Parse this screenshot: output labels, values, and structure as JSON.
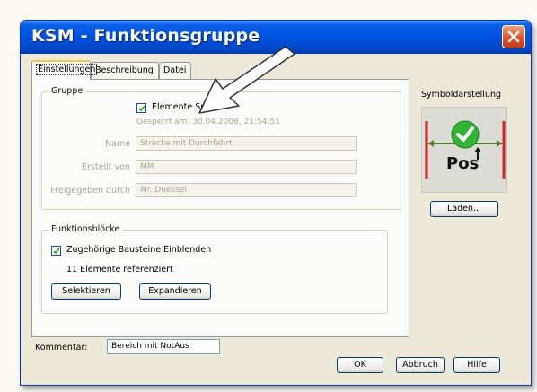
{
  "window": {
    "title": "KSM - Funktionsgruppe"
  },
  "tabs": [
    "Einstellungen",
    "Beschreibung",
    "Datei"
  ],
  "gruppe": {
    "title": "Gruppe",
    "lock_checkbox": {
      "label": "Elemente Sperren",
      "checked": true
    },
    "locked_info": "Gesperrt am: 30.04.2008, 21:54:51",
    "fields": {
      "name": {
        "label": "Name",
        "value": "Strecke mit Durchfahrt"
      },
      "created_by": {
        "label": "Erstellt von",
        "value": "MM"
      },
      "released_by": {
        "label": "Freigegeben durch",
        "value": "Mr. Duessel"
      }
    }
  },
  "funktionsbloecke": {
    "title": "Funktionsblöcke",
    "show_checkbox": {
      "label": "Zugehörige Bausteine Einblenden",
      "checked": true
    },
    "referenced": "11 Elemente referenziert",
    "select_button": "Selektieren",
    "expand_button": "Expandieren"
  },
  "symbol": {
    "title": "Symboldarstellung",
    "text": "Pos",
    "load_button": "Laden..."
  },
  "comment": {
    "label": "Kommentar:",
    "value": "Bereich mit NotAus"
  },
  "buttons": {
    "ok": "OK",
    "cancel": "Abbruch",
    "help": "Hilfe"
  },
  "colors": {
    "titlebar": "#0054e3",
    "close": "#e0532a",
    "check_green": "#2fb52f",
    "symbol_red": "#d8202a"
  },
  "icons": {
    "close": "close-icon",
    "check": "check-icon",
    "arrow": "pointer-arrow-icon"
  }
}
